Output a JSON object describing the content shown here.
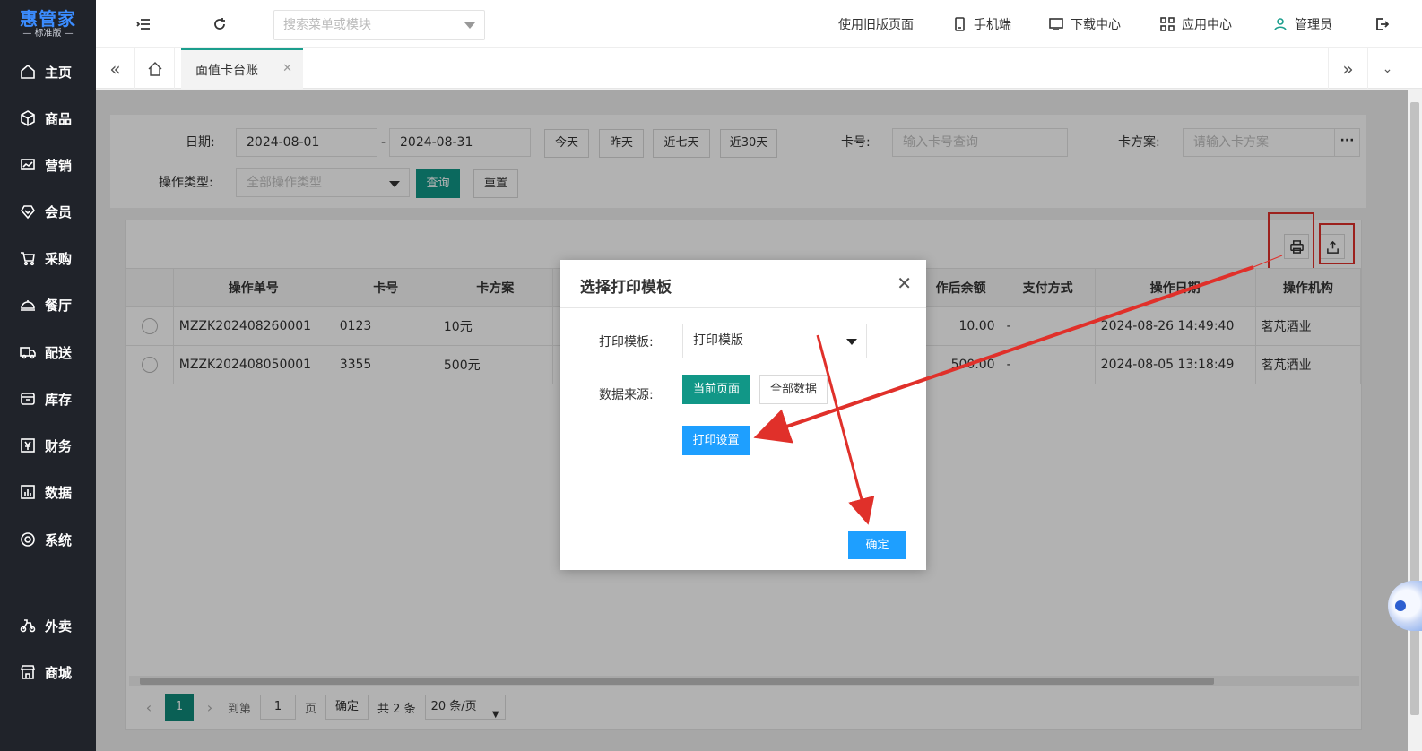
{
  "app": {
    "logo_title": "惠管家",
    "logo_sub": "— 标准版 —"
  },
  "sidebar": {
    "items": [
      {
        "label": "主页",
        "icon": "home-icon"
      },
      {
        "label": "商品",
        "icon": "box-icon"
      },
      {
        "label": "营销",
        "icon": "chart-icon"
      },
      {
        "label": "会员",
        "icon": "diamond-icon"
      },
      {
        "label": "采购",
        "icon": "cart-icon"
      },
      {
        "label": "餐厅",
        "icon": "cloche-icon"
      },
      {
        "label": "配送",
        "icon": "truck-icon"
      },
      {
        "label": "库存",
        "icon": "warehouse-icon"
      },
      {
        "label": "财务",
        "icon": "yen-icon"
      },
      {
        "label": "数据",
        "icon": "data-icon"
      },
      {
        "label": "系统",
        "icon": "settings-icon"
      },
      {
        "label": "外卖",
        "icon": "delivery-icon"
      },
      {
        "label": "商城",
        "icon": "store-icon"
      }
    ]
  },
  "topbar": {
    "search_placeholder": "搜索菜单或模块",
    "old_page": "使用旧版页面",
    "mobile": "手机端",
    "download": "下载中心",
    "apps": "应用中心",
    "user": "管理员"
  },
  "tabs": {
    "active": "面值卡台账"
  },
  "filter": {
    "date_label": "日期:",
    "date_start": "2024-08-01",
    "date_sep": "-",
    "date_end": "2024-08-31",
    "today": "今天",
    "yesterday": "昨天",
    "last7": "近七天",
    "last30": "近30天",
    "card_label": "卡号:",
    "card_placeholder": "输入卡号查询",
    "plan_label": "卡方案:",
    "plan_placeholder": "请输入卡方案",
    "more": "···",
    "op_label": "操作类型:",
    "op_value": "全部操作类型",
    "query": "查询",
    "reset": "重置"
  },
  "table": {
    "headers": [
      "",
      "操作单号",
      "卡号",
      "卡方案",
      "",
      "作后余额",
      "支付方式",
      "操作日期",
      "操作机构"
    ],
    "rows": [
      [
        "",
        "MZZK202408260001",
        "0123",
        "10元",
        "",
        "10.00",
        "-",
        "2024-08-26 14:49:40",
        "茗芃酒业"
      ],
      [
        "",
        "MZZK202408050001",
        "3355",
        "500元",
        "",
        "500.00",
        "-",
        "2024-08-05 13:18:49",
        "茗芃酒业"
      ]
    ]
  },
  "pager": {
    "prev": "‹",
    "current": "1",
    "next": "›",
    "goto": "到第",
    "page_input": "1",
    "page_unit": "页",
    "confirm": "确定",
    "total": "共 2 条",
    "page_size": "20 条/页"
  },
  "dialog": {
    "title": "选择打印模板",
    "close": "✕",
    "template_label": "打印模板:",
    "template_value": "打印模版",
    "source_label": "数据来源:",
    "current_page": "当前页面",
    "all_data": "全部数据",
    "print_settings": "打印设置",
    "ok": "确定"
  },
  "colors": {
    "sidebar_bg": "#20232a",
    "primary": "#119787",
    "blue": "#1e9fff",
    "annotation": "#e0302a"
  }
}
